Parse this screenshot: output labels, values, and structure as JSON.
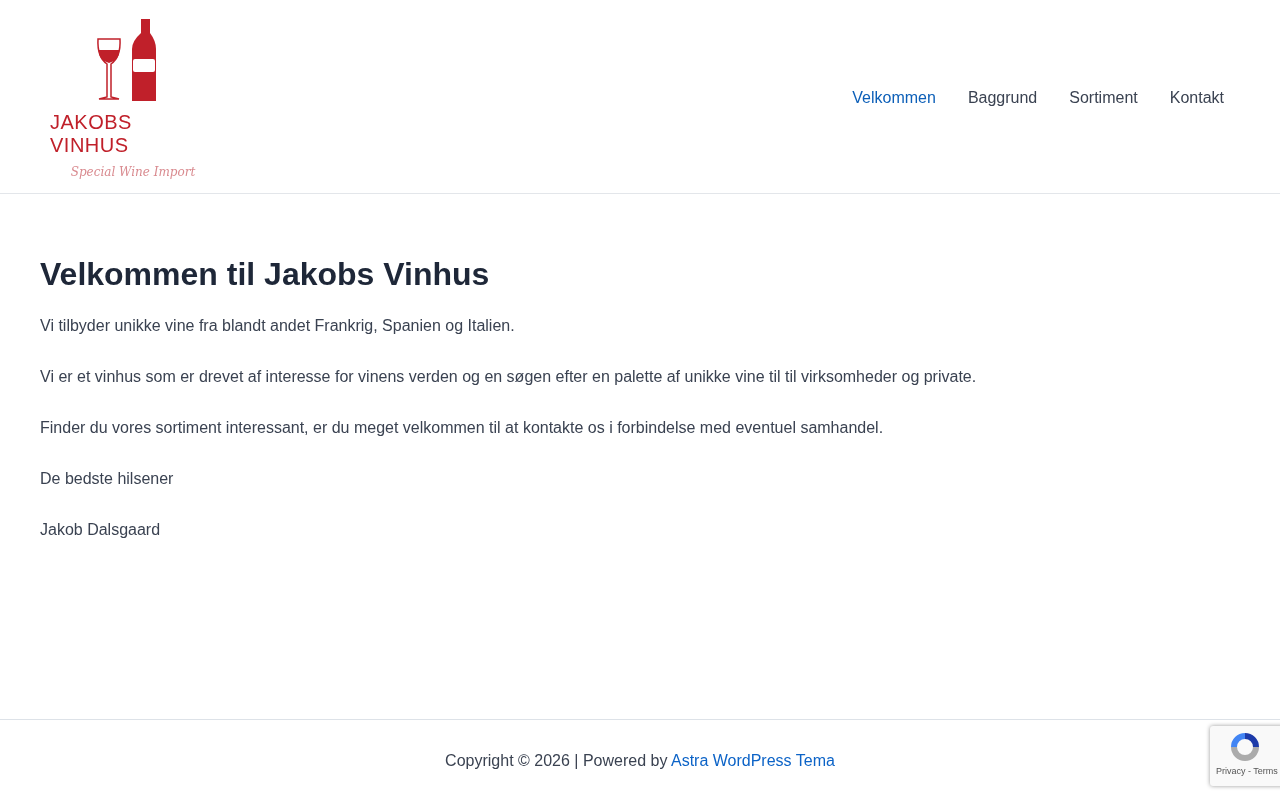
{
  "logo": {
    "name": "JAKOBS VINHUS",
    "tagline": "Special Wine Import"
  },
  "nav": [
    {
      "label": "Velkommen",
      "selected": true
    },
    {
      "label": "Baggrund",
      "selected": false
    },
    {
      "label": "Sortiment",
      "selected": false
    },
    {
      "label": "Kontakt",
      "selected": false
    }
  ],
  "heading": "Velkommen til Jakobs Vinhus",
  "paragraphs": [
    "Vi tilbyder unikke vine fra blandt andet Frankrig, Spanien og Italien.",
    "Vi er et vinhus som er drevet af interesse for vinens verden og en søgen efter en palette af unikke vine til til virksomheder og private.",
    "Finder du vores sortiment interessant, er du meget velkommen til at kontakte os i forbindelse med eventuel samhandel.",
    "De bedste hilsener",
    "Jakob Dalsgaard"
  ],
  "footer": {
    "text": "Copyright © 2026 | Powered by",
    "link": "Astra WordPress Tema"
  },
  "recaptcha": {
    "links": "Privacy - Terms"
  }
}
